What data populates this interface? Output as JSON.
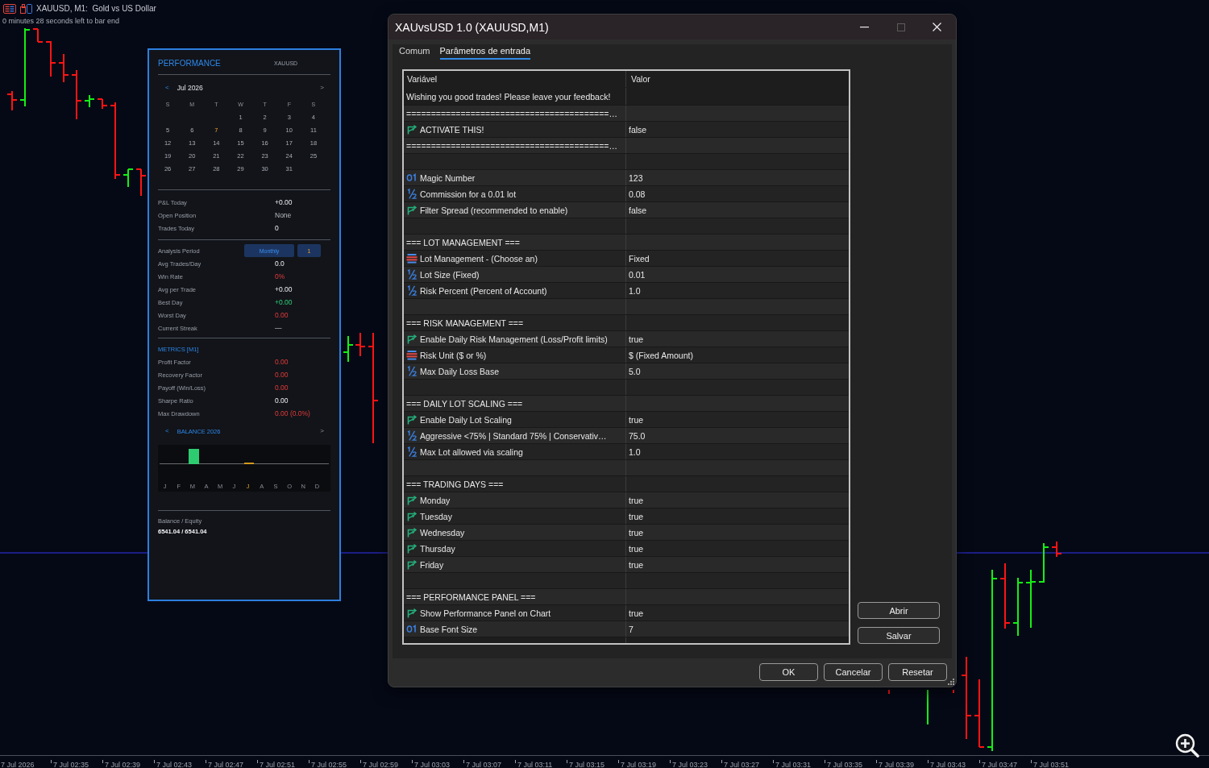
{
  "chart": {
    "title": "XAUUSD, M1:  Gold vs US Dollar",
    "timer": "0 minutes 28 seconds left to bar end",
    "time_axis": [
      "7 Jul 2026",
      "7 Jul 02:35",
      "7 Jul 02:39",
      "7 Jul 02:43",
      "7 Jul 02:47",
      "7 Jul 02:51",
      "7 Jul 02:55",
      "7 Jul 02:59",
      "7 Jul 03:03",
      "7 Jul 03:07",
      "7 Jul 03:11",
      "7 Jul 03:15",
      "7 Jul 03:19",
      "7 Jul 03:23",
      "7 Jul 03:27",
      "7 Jul 03:31",
      "7 Jul 03:35",
      "7 Jul 03:39",
      "7 Jul 03:43",
      "7 Jul 03:47",
      "7 Jul 03:51"
    ]
  },
  "performance_panel": {
    "title": "PERFORMANCE",
    "symbol": "XAUUSD",
    "calendar": {
      "prev": "<",
      "month": "Jul 2026",
      "next": ">",
      "weekdays": [
        "S",
        "M",
        "T",
        "W",
        "T",
        "F",
        "S"
      ],
      "weeks": [
        [
          {
            "day": "1",
            "today": false
          },
          {
            "day": "2",
            "today": false
          },
          {
            "day": "3",
            "today": false
          },
          {
            "day": "4",
            "today": false
          }
        ],
        [
          {
            "day": "5",
            "today": false
          },
          {
            "day": "6",
            "today": false
          },
          {
            "day": "7",
            "today": true
          },
          {
            "day": "8",
            "today": false
          },
          {
            "day": "9",
            "today": false
          },
          {
            "day": "10",
            "today": false
          },
          {
            "day": "11",
            "today": false
          }
        ],
        [
          {
            "day": "12",
            "today": false
          },
          {
            "day": "13",
            "today": false
          },
          {
            "day": "14",
            "today": false
          },
          {
            "day": "15",
            "today": false
          },
          {
            "day": "16",
            "today": false
          },
          {
            "day": "17",
            "today": false
          },
          {
            "day": "18",
            "today": false
          }
        ],
        [
          {
            "day": "19",
            "today": false
          },
          {
            "day": "20",
            "today": false
          },
          {
            "day": "21",
            "today": false
          },
          {
            "day": "22",
            "today": false
          },
          {
            "day": "23",
            "today": false
          },
          {
            "day": "24",
            "today": false
          },
          {
            "day": "25",
            "today": false
          }
        ],
        [
          {
            "day": "26",
            "today": false
          },
          {
            "day": "27",
            "today": false
          },
          {
            "day": "28",
            "today": false
          },
          {
            "day": "29",
            "today": false
          },
          {
            "day": "30",
            "today": false
          },
          {
            "day": "31",
            "today": false
          }
        ]
      ]
    },
    "today_stats": [
      {
        "label": "P&L Today",
        "value": "+0.00",
        "kind": "neutral"
      },
      {
        "label": "Open Position",
        "value": "None",
        "kind": "muted"
      },
      {
        "label": "Trades Today",
        "value": "0",
        "kind": "neutral"
      }
    ],
    "analysis_period": {
      "label": "Analysis Period",
      "period": "Monthly",
      "count": "1"
    },
    "period_stats": [
      {
        "label": "Avg Trades/Day",
        "value": "0.0",
        "kind": "neutral"
      },
      {
        "label": "Win Rate",
        "value": "0%",
        "kind": "negative"
      },
      {
        "label": "Avg per Trade",
        "value": "+0.00",
        "kind": "neutral"
      },
      {
        "label": "Best Day",
        "value": "+0.00",
        "kind": "positive"
      },
      {
        "label": "Worst Day",
        "value": "0.00",
        "kind": "negative"
      },
      {
        "label": "Current Streak",
        "value": "—",
        "kind": "muted"
      }
    ],
    "metrics_title": "METRICS [M1]",
    "metrics": [
      {
        "label": "Profit Factor",
        "value": "0.00",
        "kind": "negative"
      },
      {
        "label": "Recovery Factor",
        "value": "0.00",
        "kind": "negative"
      },
      {
        "label": "Payoff (Win/Loss)",
        "value": "0.00",
        "kind": "negative"
      },
      {
        "label": "Sharpe Ratio",
        "value": "0.00",
        "kind": "neutral"
      },
      {
        "label": "Max Drawdown",
        "value": "0.00 (0.0%)",
        "kind": "negative"
      }
    ],
    "balance": {
      "prev": "<",
      "title": "BALANCE 2026",
      "next": ">",
      "months": [
        {
          "label": "J",
          "gain": false,
          "current": false
        },
        {
          "label": "F",
          "gain": false,
          "current": false
        },
        {
          "label": "M",
          "gain": true,
          "current": false
        },
        {
          "label": "A",
          "gain": false,
          "current": false
        },
        {
          "label": "M",
          "gain": false,
          "current": false
        },
        {
          "label": "J",
          "gain": false,
          "current": false
        },
        {
          "label": "J",
          "gain": false,
          "current": true
        },
        {
          "label": "A",
          "gain": false,
          "current": false
        },
        {
          "label": "S",
          "gain": false,
          "current": false
        },
        {
          "label": "O",
          "gain": false,
          "current": false
        },
        {
          "label": "N",
          "gain": false,
          "current": false
        },
        {
          "label": "D",
          "gain": false,
          "current": false
        }
      ]
    },
    "balance_equity": {
      "label": "Balance / Equity",
      "value": "6541.04 / 6541.04"
    }
  },
  "dialog": {
    "title": "XAUvsUSD 1.0 (XAUUSD,M1)",
    "maximize_disabled": true,
    "tabs": [
      {
        "label": "Comum",
        "selected": false
      },
      {
        "label": "Parâmetros de entrada",
        "selected": true
      }
    ],
    "table": {
      "columns": [
        "Variável",
        "Valor"
      ],
      "note": "Wishing you good trades! Please leave your feedback!",
      "rows": [
        {
          "kind": "separator",
          "name": "=========================================…"
        },
        {
          "kind": "bool",
          "name": "ACTIVATE THIS!",
          "value": "false"
        },
        {
          "kind": "separator",
          "name": "=========================================…"
        },
        {
          "kind": "blank"
        },
        {
          "kind": "int",
          "name": "Magic Number",
          "value": "123"
        },
        {
          "kind": "double",
          "name": "Commission for a 0.01 lot",
          "value": "0.08"
        },
        {
          "kind": "bool",
          "name": "Filter Spread (recommended to enable)",
          "value": "false"
        },
        {
          "kind": "blank"
        },
        {
          "kind": "section",
          "name": "=== LOT MANAGEMENT ==="
        },
        {
          "kind": "enum",
          "name": "Lot Management - (Choose an)",
          "value": "Fixed"
        },
        {
          "kind": "double",
          "name": "Lot Size (Fixed)",
          "value": "0.01"
        },
        {
          "kind": "double",
          "name": "Risk Percent (Percent of Account)",
          "value": "1.0"
        },
        {
          "kind": "blank"
        },
        {
          "kind": "section",
          "name": "=== RISK MANAGEMENT ==="
        },
        {
          "kind": "bool",
          "name": "Enable Daily Risk Management (Loss/Profit limits)",
          "value": "true"
        },
        {
          "kind": "enum",
          "name": "Risk Unit ($ or %)",
          "value": "$ (Fixed Amount)"
        },
        {
          "kind": "double",
          "name": "Max Daily Loss Base",
          "value": "5.0"
        },
        {
          "kind": "blank"
        },
        {
          "kind": "section",
          "name": "=== DAILY LOT SCALING ==="
        },
        {
          "kind": "bool",
          "name": "Enable Daily Lot Scaling",
          "value": "true"
        },
        {
          "kind": "double",
          "name": "Aggressive <75% | Standard 75% | Conservativ…",
          "value": "75.0"
        },
        {
          "kind": "double",
          "name": "Max Lot allowed via scaling",
          "value": "1.0"
        },
        {
          "kind": "blank"
        },
        {
          "kind": "section",
          "name": "=== TRADING DAYS ==="
        },
        {
          "kind": "bool",
          "name": "Monday",
          "value": "true"
        },
        {
          "kind": "bool",
          "name": "Tuesday",
          "value": "true"
        },
        {
          "kind": "bool",
          "name": "Wednesday",
          "value": "true"
        },
        {
          "kind": "bool",
          "name": "Thursday",
          "value": "true"
        },
        {
          "kind": "bool",
          "name": "Friday",
          "value": "true"
        },
        {
          "kind": "blank"
        },
        {
          "kind": "section",
          "name": "=== PERFORMANCE PANEL ==="
        },
        {
          "kind": "bool",
          "name": "Show Performance Panel on Chart",
          "value": "true"
        },
        {
          "kind": "int",
          "name": "Base Font Size",
          "value": "7"
        }
      ]
    },
    "side_buttons": [
      "Abrir",
      "Salvar"
    ],
    "buttons": [
      "OK",
      "Cancelar",
      "Resetar"
    ]
  }
}
